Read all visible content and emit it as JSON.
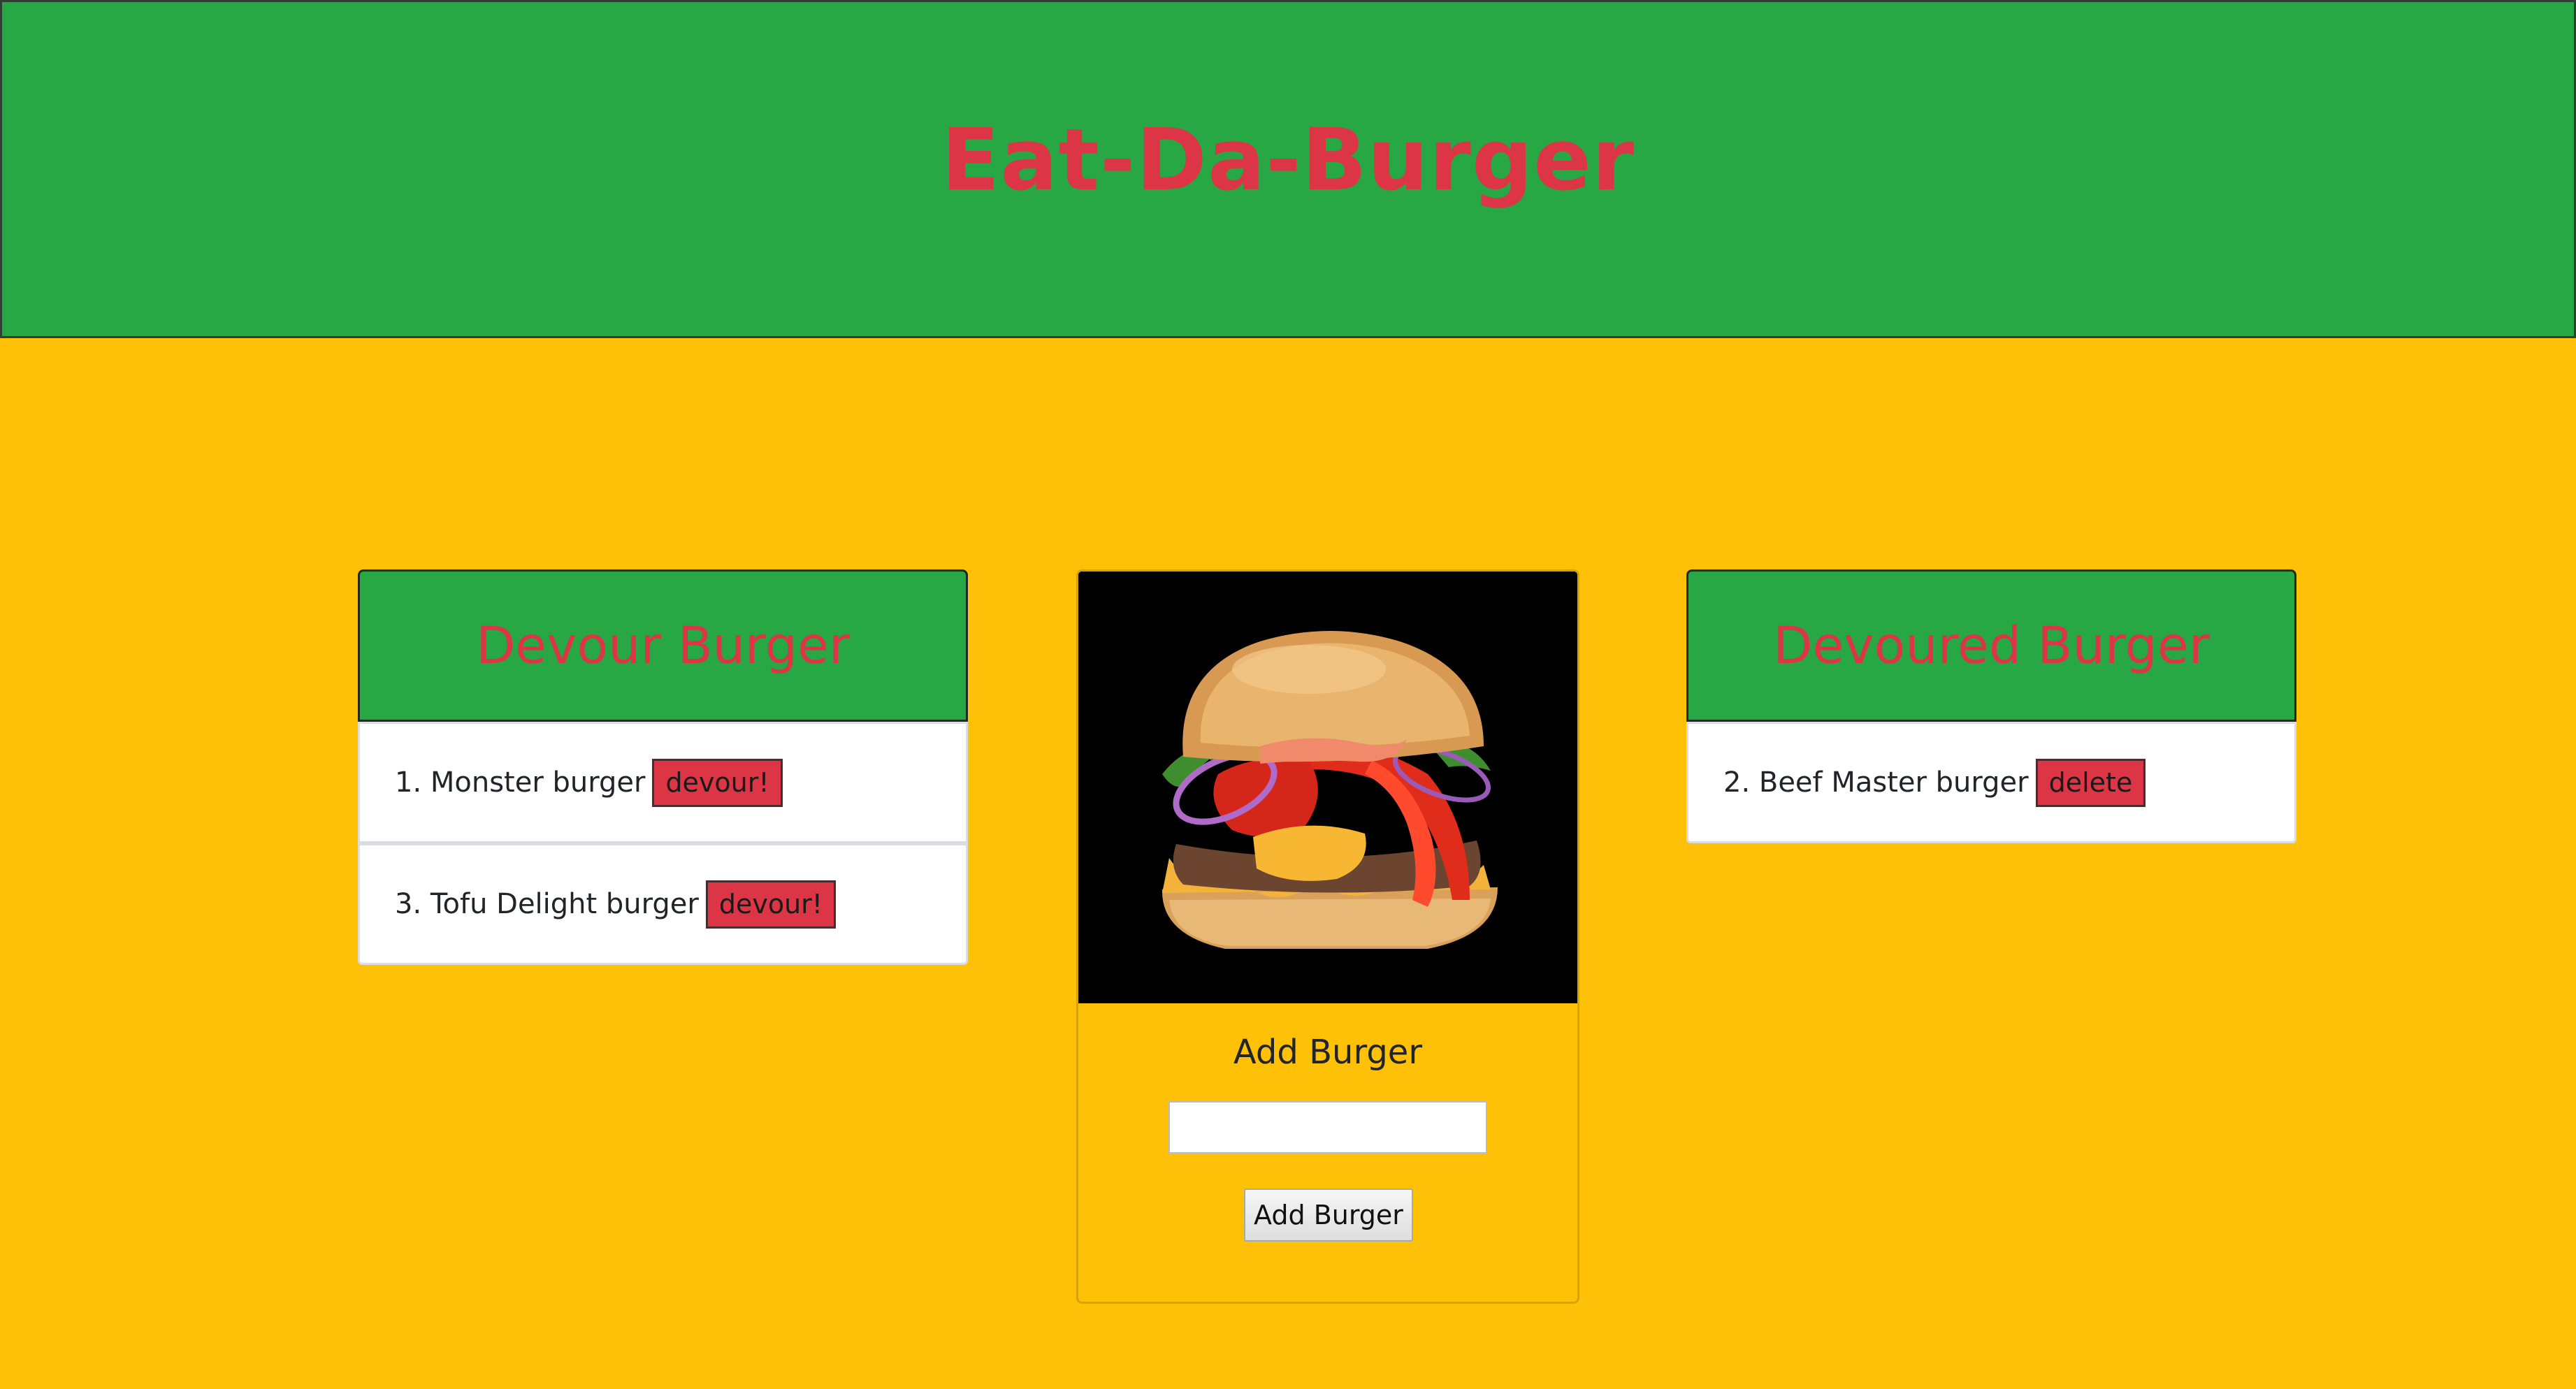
{
  "header": {
    "title": "Eat-Da-Burger"
  },
  "devour_panel": {
    "title": "Devour Burger",
    "items": [
      {
        "text": "1. Monster burger",
        "button": "devour!"
      },
      {
        "text": "3. Tofu Delight burger",
        "button": "devour!"
      }
    ]
  },
  "devoured_panel": {
    "title": "Devoured Burger",
    "items": [
      {
        "text": "2. Beef Master burger",
        "button": "delete"
      }
    ]
  },
  "add_form": {
    "heading": "Add Burger",
    "input_value": "",
    "button_label": "Add Burger"
  },
  "colors": {
    "background": "#ffc107",
    "header": "#28a745",
    "accent_red": "#dc3545",
    "card": "#ffffff"
  },
  "icons": {
    "hero_image": "burger-photo"
  }
}
